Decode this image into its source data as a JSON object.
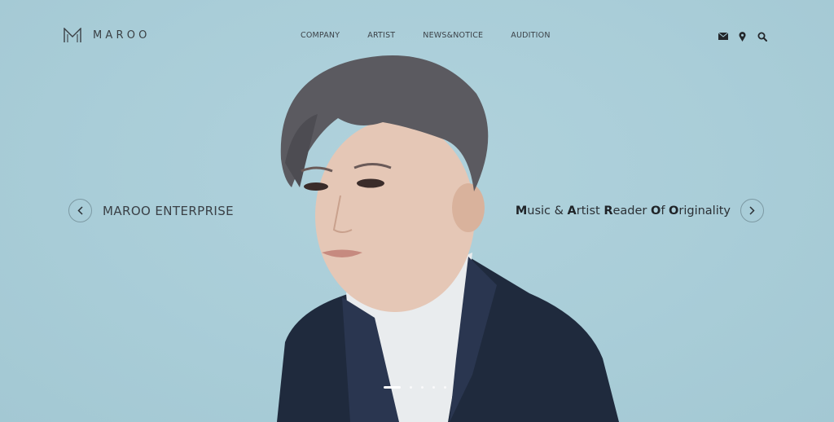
{
  "brand": {
    "name": "MAROO",
    "logo_icon": "maroo-m-logo"
  },
  "nav": {
    "items": [
      {
        "label": "COMPANY"
      },
      {
        "label": "ARTIST"
      },
      {
        "label": "NEWS&NOTICE"
      },
      {
        "label": "AUDITION"
      }
    ]
  },
  "utility": {
    "icons": [
      "mail-icon",
      "location-pin-icon",
      "search-icon"
    ]
  },
  "hero": {
    "left_caption": "MAROO ENTERPRISE",
    "right_caption_parts": [
      {
        "text": "M",
        "bold": true
      },
      {
        "text": "usic & ",
        "bold": false
      },
      {
        "text": "A",
        "bold": true
      },
      {
        "text": "rtist ",
        "bold": false
      },
      {
        "text": "R",
        "bold": true
      },
      {
        "text": "eader ",
        "bold": false
      },
      {
        "text": "O",
        "bold": true
      },
      {
        "text": "f ",
        "bold": false
      },
      {
        "text": "O",
        "bold": true
      },
      {
        "text": "riginality",
        "bold": false
      }
    ],
    "prev_icon": "chevron-left-icon",
    "next_icon": "chevron-right-icon",
    "slides_total": 5,
    "active_slide": 1
  },
  "colors": {
    "background": "#a8ccd7",
    "text": "#2b2f33",
    "jacket": "#1f2a3d",
    "hair": "#5b5a60"
  }
}
